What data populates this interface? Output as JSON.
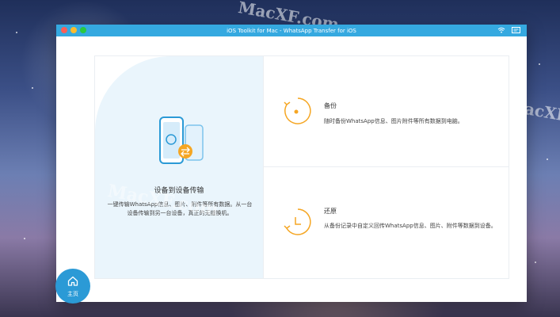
{
  "window": {
    "title": "iOS Toolkit for Mac - WhatsApp Transfer for iOS"
  },
  "watermarks": [
    "MacXF.com",
    "MacXF.",
    "MacXF.com"
  ],
  "transfer": {
    "title": "设备到设备传输",
    "desc_line1": "一键传输WhatsApp信息、图片、附件等所有数据。从一台",
    "desc_line2": "设备传输到另一台设备，真正的无缝换机。"
  },
  "backup": {
    "title": "备份",
    "desc": "随时备份WhatsApp信息、图片附件等所有数据到电脑。"
  },
  "restore": {
    "title": "还原",
    "desc": "从备份记录中自定义回传WhatsApp信息、图片、附件等数据到设备。"
  },
  "home": {
    "label": "主页"
  },
  "colors": {
    "accent": "#2b9ad6",
    "titlebar": "#35a9e0",
    "orange": "#f5a623",
    "panel": "#eaf5fc"
  },
  "icons": [
    "wifi-icon",
    "feedback-icon",
    "phone-transfer-icon",
    "backup-icon",
    "restore-icon",
    "home-icon"
  ]
}
